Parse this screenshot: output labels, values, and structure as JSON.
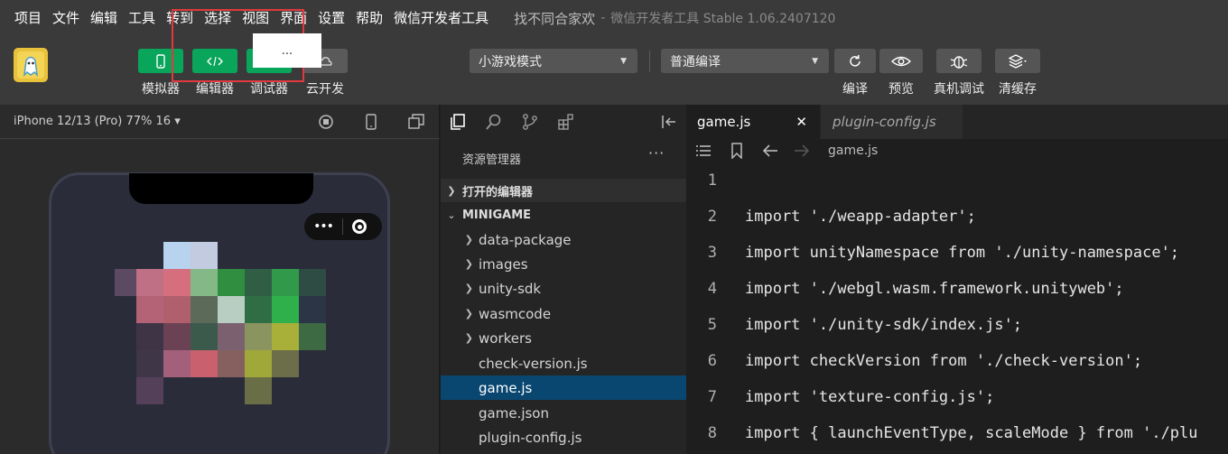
{
  "menubar": {
    "items": [
      "项目",
      "文件",
      "编辑",
      "工具",
      "转到",
      "选择",
      "视图",
      "界面",
      "设置",
      "帮助",
      "微信开发者工具"
    ],
    "project_title": "找不同合家欢",
    "separator": "-",
    "app_version": "微信开发者工具 Stable 1.06.2407120"
  },
  "toolbar": {
    "simulator_label": "模拟器",
    "editor_label": "编辑器",
    "debugger_label": "调试器",
    "cloud_label": "云开发",
    "popup_text": "...",
    "mode_select": "小游戏模式",
    "compile_select": "普通编译",
    "compile_label": "编译",
    "preview_label": "预览",
    "realdevice_label": "真机调试",
    "clearcache_label": "清缓存"
  },
  "simulator": {
    "device": "iPhone 12/13 (Pro) 77% 16 ▾",
    "capsule_dots": "•••"
  },
  "explorer": {
    "title": "资源管理器",
    "more": "···",
    "open_editors": "打开的编辑器",
    "project": "MINIGAME",
    "folders": [
      "data-package",
      "images",
      "unity-sdk",
      "wasmcode",
      "workers"
    ],
    "files": [
      "check-version.js",
      "game.js",
      "game.json",
      "plugin-config.js"
    ],
    "selected_file": "game.js"
  },
  "editor": {
    "tabs": [
      {
        "label": "game.js",
        "active": true
      },
      {
        "label": "plugin-config.js",
        "active": false
      }
    ],
    "close_symbol": "✕",
    "breadcrumb_file": "game.js",
    "lines": [
      {
        "n": "1",
        "text": ""
      },
      {
        "n": "2",
        "text": "import './weapp-adapter';"
      },
      {
        "n": "3",
        "text": "import unityNamespace from './unity-namespace';"
      },
      {
        "n": "4",
        "text": "import './webgl.wasm.framework.unityweb';"
      },
      {
        "n": "5",
        "text": "import './unity-sdk/index.js';"
      },
      {
        "n": "6",
        "text": "import checkVersion from './check-version';"
      },
      {
        "n": "7",
        "text": "import 'texture-config.js';"
      },
      {
        "n": "8",
        "text": "import { launchEventType, scaleMode } from './plu"
      }
    ]
  },
  "colors": {
    "accent_green": "#09a55b",
    "highlight_red": "#e0393e",
    "selection_blue": "#094771"
  }
}
